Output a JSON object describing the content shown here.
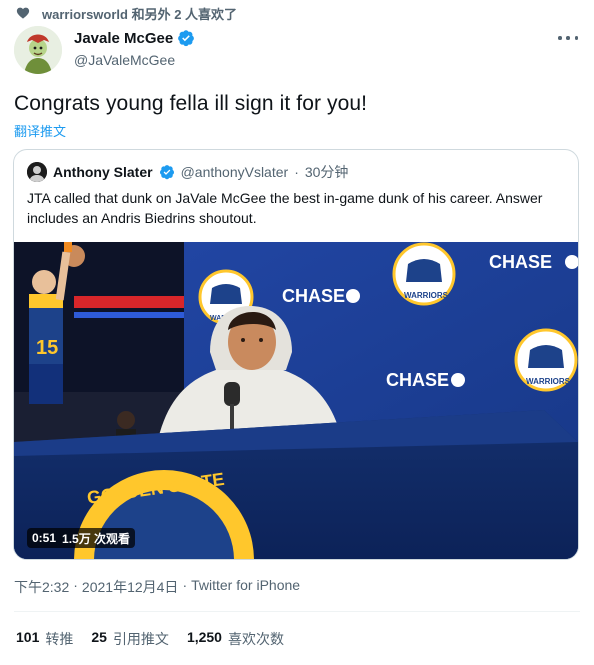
{
  "social_context": {
    "text": "warriorsworld 和另外 2 人喜欢了"
  },
  "author": {
    "name": "Javale McGee",
    "handle": "@JaValeMcGee"
  },
  "tweet": {
    "text": "Congrats young fella ill sign it for you!",
    "translate_label": "翻译推文"
  },
  "quoted": {
    "name": "Anthony Slater",
    "handle": "@anthonyVslater",
    "separator": "·",
    "time": "30分钟",
    "text": "JTA called that dunk on JaVale McGee the best in-game dunk of his career. Answer includes an Andris Biedrins shoutout.",
    "video": {
      "duration": "0:51",
      "views": "1.5万 次观看",
      "signage": {
        "sponsor": "CHASE",
        "team_logo": "GOLDEN STATE",
        "team_word": "WARRIORS",
        "jersey_number": "15"
      }
    }
  },
  "meta": {
    "time": "下午2:32",
    "separator1": "·",
    "date": "2021年12月4日",
    "separator2": "·",
    "source": "Twitter for iPhone"
  },
  "stats": [
    {
      "value": "101",
      "label": "转推"
    },
    {
      "value": "25",
      "label": "引用推文"
    },
    {
      "value": "1,250",
      "label": "喜欢次数"
    }
  ],
  "colors": {
    "accent": "#1d9bf0",
    "secondary_text": "#536471",
    "border": "#cfd9de",
    "warriors_blue": "#1d428a",
    "warriors_gold": "#ffc72c"
  },
  "icons": {
    "liked": "heart-icon",
    "verified": "verified-badge-icon",
    "more": "more-options-icon"
  }
}
